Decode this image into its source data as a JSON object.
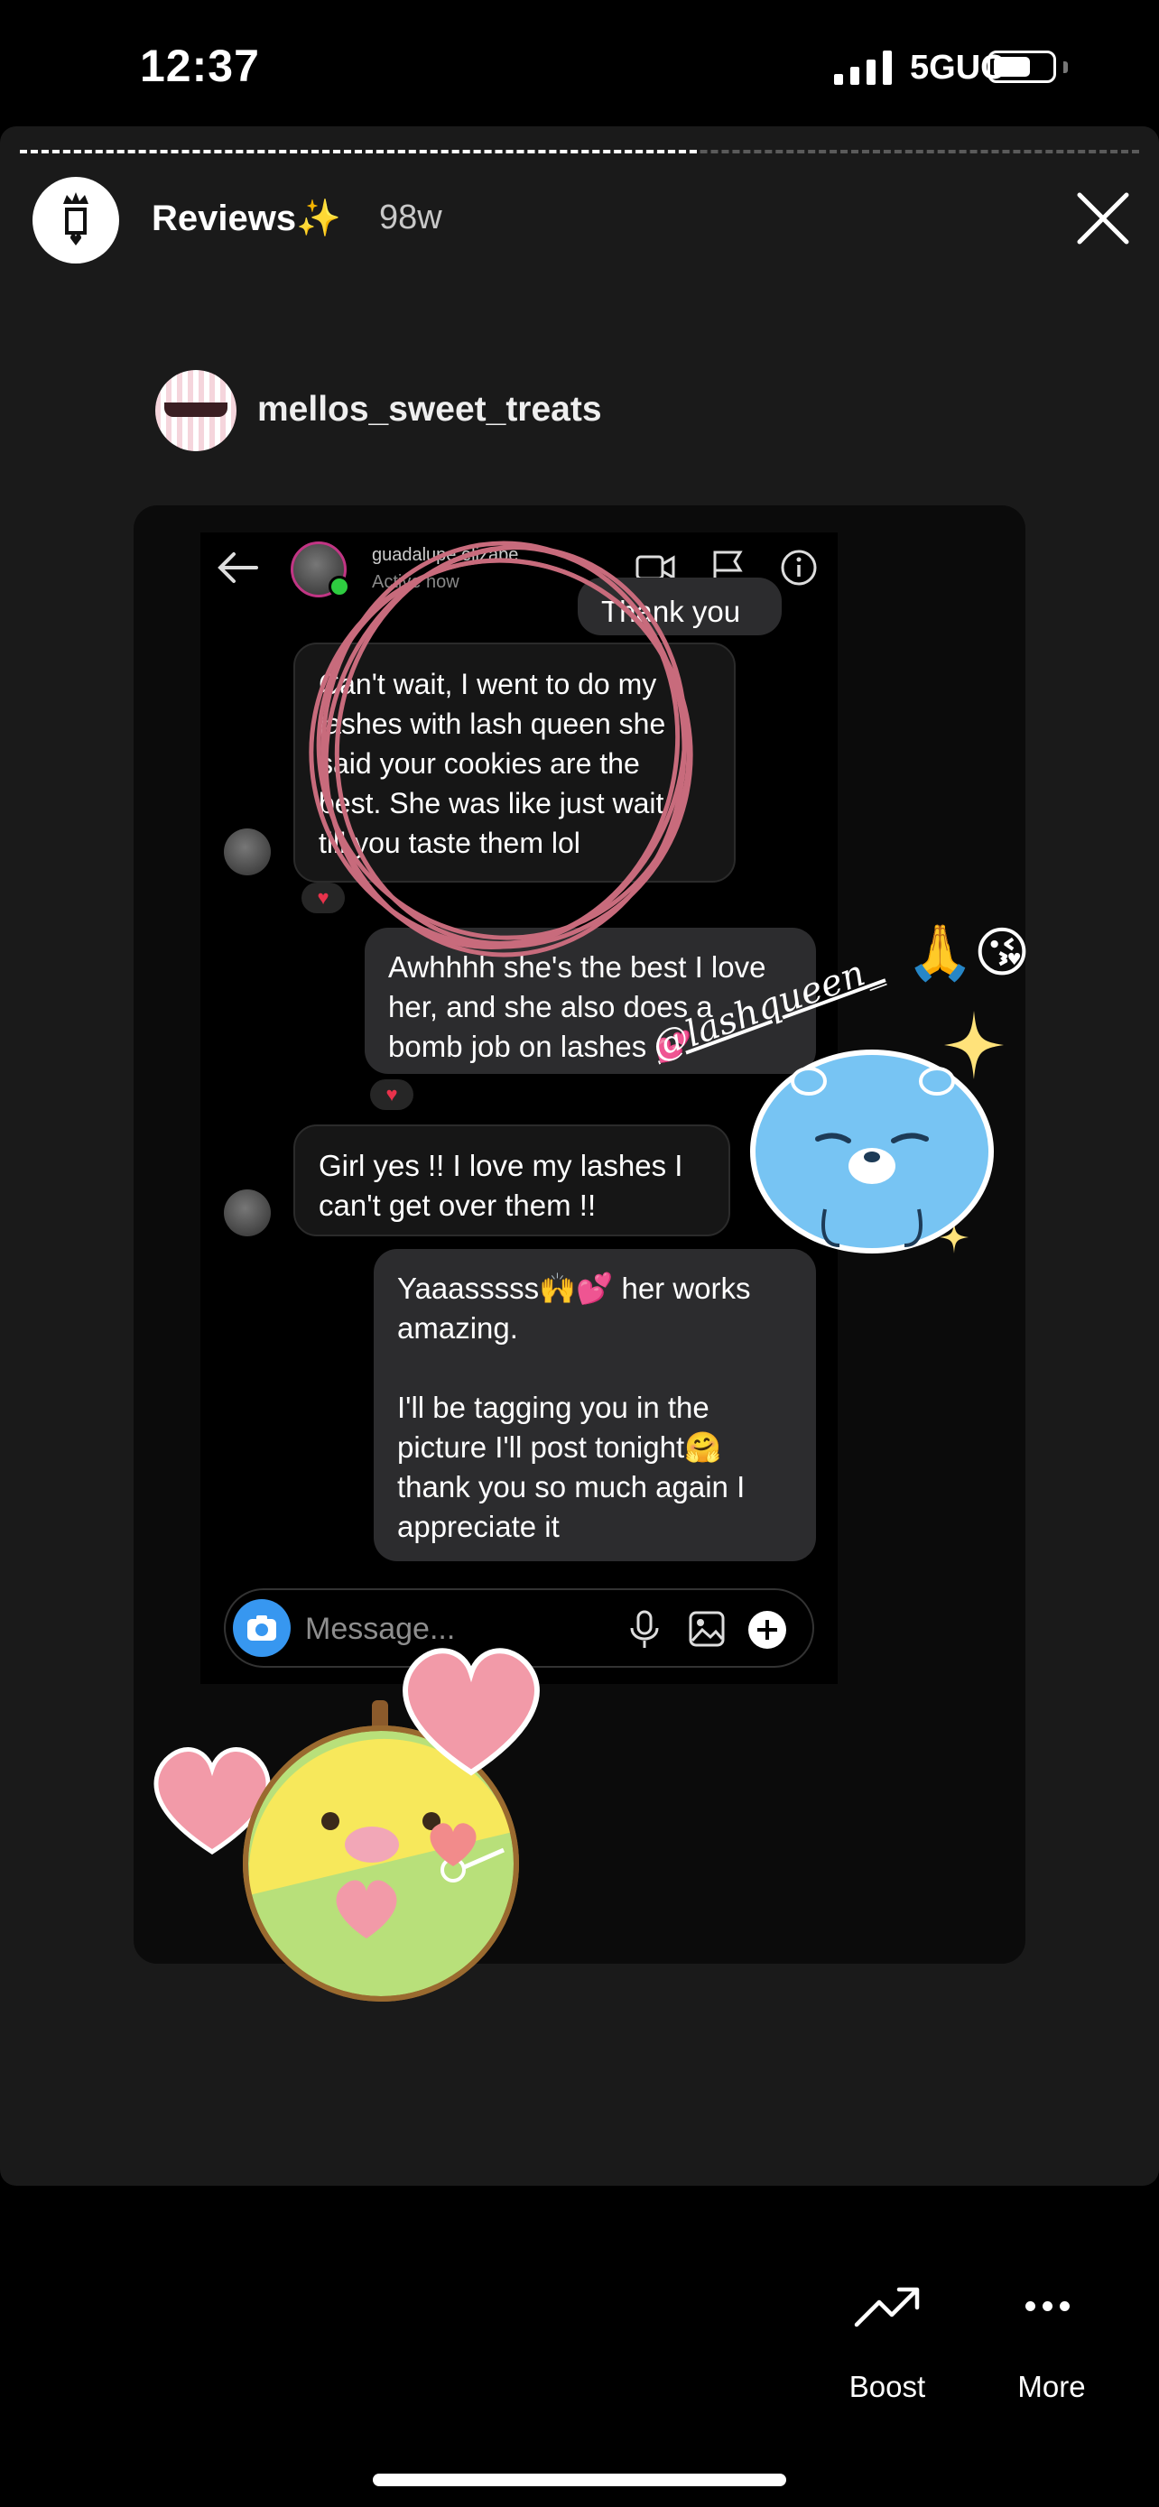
{
  "status": {
    "time": "12:37",
    "network": "5GUC"
  },
  "story": {
    "title": "Reviews✨",
    "age": "98w",
    "post_username": "mellos_sweet_treats"
  },
  "dm": {
    "contact": "guadalupe elizabe",
    "contact_status": "Active now",
    "top_partial": "Thank you",
    "messages": [
      {
        "side": "in",
        "text": "Can't wait, I went to do my\nlashes with lash queen she\nsaid your cookies are the\nbest. She was like just wait\ntill you taste them lol"
      },
      {
        "side": "out",
        "text": "Awhhhh she's the best I love\nher, and she also does a\nbomb job on lashes 💕"
      },
      {
        "side": "in",
        "text": "Girl yes !! I love my lashes I\ncan't get over them !!"
      },
      {
        "side": "out",
        "text": "Yaaasssss🙌💕 her works\namazing.\n\nI'll be tagging you in the\npicture I'll post tonight🤗\nthank you so much again I\nappreciate it"
      }
    ],
    "reaction_icon": "heart-reaction-icon",
    "composer_placeholder": "Message..."
  },
  "sticker": {
    "mention": "@lashqueen_",
    "emojis": "🙏😘"
  },
  "actions": {
    "boost": "Boost",
    "more": "More"
  },
  "colors": {
    "accent_blue": "#3797f0",
    "reaction_red": "#e8324b",
    "circle_pink": "#c86b7c"
  }
}
